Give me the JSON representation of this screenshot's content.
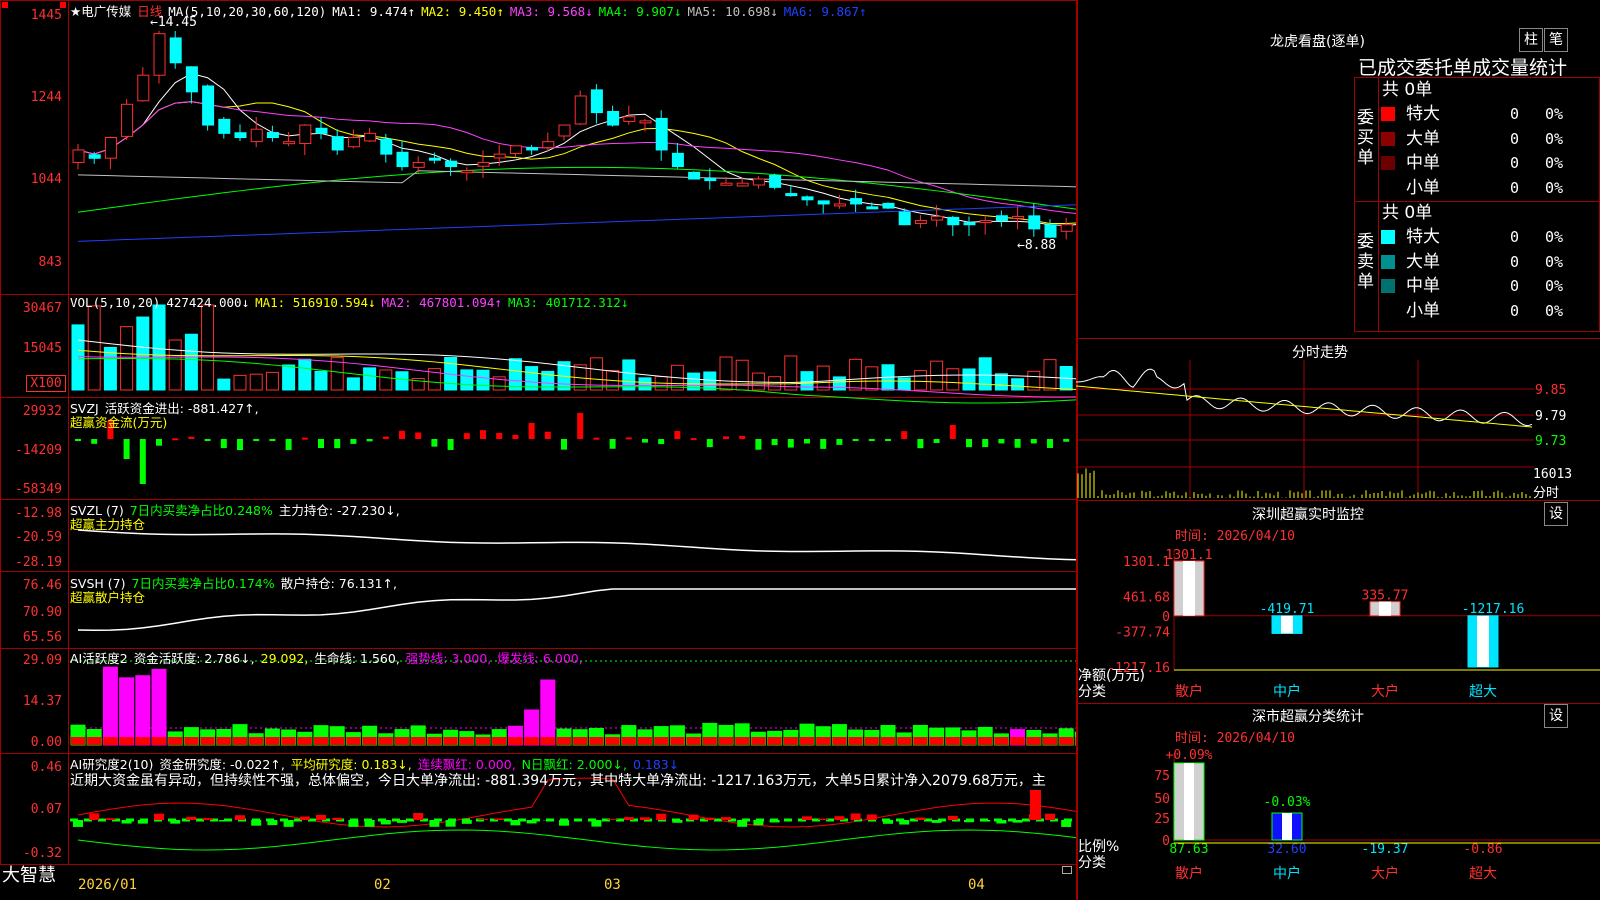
{
  "stock": {
    "name": "★电广传媒",
    "period": "日线",
    "ma_header": "MA(5,10,20,30,60,120)",
    "ma": [
      {
        "label": "MA1: 9.474↑",
        "color": "#ffffff"
      },
      {
        "label": "MA2: 9.450↑",
        "color": "#ffff00"
      },
      {
        "label": "MA3: 9.568↓",
        "color": "#ff40ff"
      },
      {
        "label": "MA4: 9.907↓",
        "color": "#00ff00"
      },
      {
        "label": "MA5: 10.698↓",
        "color": "#c0c0c0"
      },
      {
        "label": "MA6: 9.867↑",
        "color": "#2040ff"
      }
    ],
    "high_label": "←14.45",
    "low_label": "←8.88"
  },
  "axes": {
    "price": [
      "1445",
      "1244",
      "1044",
      "843"
    ],
    "vol": [
      "30467",
      "15045",
      "X100"
    ],
    "flow": [
      "29932",
      "-14209",
      "-58349"
    ],
    "main": [
      "-12.98",
      "-20.59",
      "-28.19"
    ],
    "retail": [
      "76.46",
      "70.90",
      "65.56"
    ],
    "active": [
      "29.09",
      "14.37",
      "0.00"
    ],
    "research": [
      "0.46",
      "0.07",
      "-0.32"
    ],
    "dates": [
      "2026/01",
      "02",
      "03",
      "04"
    ]
  },
  "vol_header": {
    "title": "VOL(5,10,20)",
    "items": [
      {
        "label": "427424.000↓",
        "color": "#ffffff"
      },
      {
        "label": "MA1: 516910.594↓",
        "color": "#ffff00"
      },
      {
        "label": "MA2: 467801.094↑",
        "color": "#ff40ff"
      },
      {
        "label": "MA3: 401712.312↓",
        "color": "#00ff00"
      }
    ]
  },
  "flow_header": {
    "title": "SVZJ",
    "text": "活跃资金进出: -881.427↑,",
    "sub": "超赢资金流(万元)"
  },
  "main_header": {
    "title": "SVZL (7)",
    "green": "7日内买卖净占比0.248%",
    "text": "主力持仓: -27.230↓,",
    "sub": "超赢主力持仓"
  },
  "retail_header": {
    "title": "SVSH (7)",
    "green": "7日内买卖净占比0.174%",
    "text": "散户持仓: 76.131↑,",
    "sub": "超赢散户持仓"
  },
  "active_header": {
    "title": "AI活跃度2",
    "a": "资金活跃度: 2.786↓,",
    "b": "29.092,",
    "c": "生命线: 1.560,",
    "d": "强势线: 3.000,",
    "e": "爆发线: 6.000,"
  },
  "research_header": {
    "title": "AI研究度2(10)",
    "a": "资金研究度: -0.022↑,",
    "b": "平均研究度: 0.183↓,",
    "c": "连续飘红: 0.000,",
    "d": "N日飘红: 2.000↓,",
    "e": "0.183↓"
  },
  "commentary": "近期大资金虽有异动，但持续性不强，总体偏空，今日大单净流出: -881.394万元，其中特大单净流出: -1217.163万元，大单5日累计净入2079.68万元，主",
  "footer": {
    "brand": "大智慧"
  },
  "dragon": {
    "title": "龙虎看盘(逐单)",
    "btn1": "柱",
    "btn2": "笔",
    "sub": "已成交委托单成交量统计",
    "buy": {
      "label": "委买单",
      "total": "共 0单",
      "rows": [
        {
          "name": "特大",
          "count": "0",
          "pct": "0%",
          "color": "#ff0000"
        },
        {
          "name": "大单",
          "count": "0",
          "pct": "0%",
          "color": "#8b0000"
        },
        {
          "name": "中单",
          "count": "0",
          "pct": "0%",
          "color": "#6a0000"
        },
        {
          "name": "小单",
          "count": "0",
          "pct": "0%",
          "color": ""
        }
      ]
    },
    "sell": {
      "label": "委卖单",
      "total": "共 0单",
      "rows": [
        {
          "name": "特大",
          "count": "0",
          "pct": "0%",
          "color": "#00ffff"
        },
        {
          "name": "大单",
          "count": "0",
          "pct": "0%",
          "color": "#009090"
        },
        {
          "name": "中单",
          "count": "0",
          "pct": "0%",
          "color": "#007070"
        },
        {
          "name": "小单",
          "count": "0",
          "pct": "0%",
          "color": ""
        }
      ]
    }
  },
  "intraday": {
    "title": "分时走势",
    "levels": [
      "9.85",
      "9.79",
      "9.73",
      "16013",
      "分时"
    ]
  },
  "sz_monitor": {
    "title": "深圳超赢实时监控",
    "btn": "设",
    "time": "时间: 2026/04/10",
    "yaxis": [
      "1301.1",
      "461.68",
      "0",
      "-377.74",
      "-1217.16"
    ],
    "ylabel": "净额(万元)",
    "xlabel": "分类",
    "cats": [
      "散户",
      "中户",
      "大户",
      "超大"
    ],
    "values": [
      1301.1,
      -419.71,
      335.77,
      -1217.16
    ],
    "value_labels": [
      "1301.1",
      "-419.71",
      "335.77",
      "-1217.16"
    ]
  },
  "sz_class": {
    "title": "深市超赢分类统计",
    "btn": "设",
    "time": "时间: 2026/04/10",
    "yaxis": [
      "75",
      "50",
      "25",
      "0"
    ],
    "ylabel": "比例%",
    "xlabel": "分类",
    "cats": [
      "散户",
      "中户",
      "大户",
      "超大"
    ],
    "top_labels": [
      "+0.09%",
      "-0.03%",
      "",
      ""
    ],
    "bottom": [
      "87.63",
      "32.60",
      "-19.37",
      "-0.86"
    ]
  }
}
